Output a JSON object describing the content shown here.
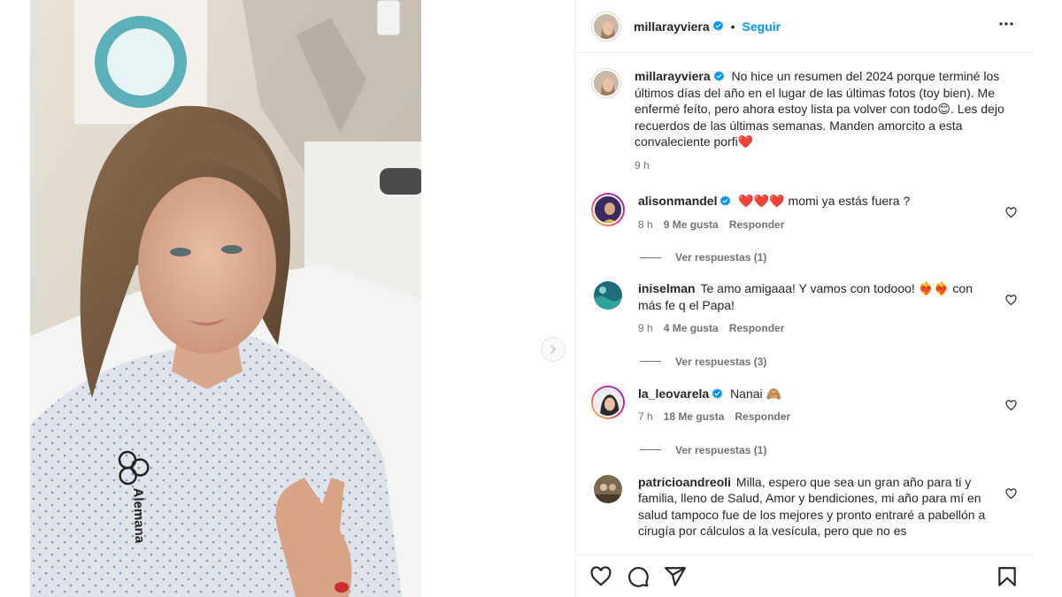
{
  "post": {
    "author": "millarayviera",
    "follow_label": "Seguir",
    "caption": "No hice un resumen del 2024 porque terminé los últimos días del año en el lugar de las últimas fotos (toy bien). Me enfermé feíto, pero ahora estoy lista pa volver con todo😊. Les dejo recuerdos de las últimas semanas. Manden amorcito a esta convaleciente porfi❤️",
    "caption_time": "9 h"
  },
  "photo": {
    "gown_logo_text": "Alemana"
  },
  "comments": [
    {
      "username": "alisonmandel",
      "verified": true,
      "text": "❤️❤️❤️ momi ya estás fuera ?",
      "time": "8 h",
      "likes": "9 Me gusta",
      "reply_label": "Responder",
      "view_replies": "Ver respuestas (1)"
    },
    {
      "username": "iniselman",
      "verified": false,
      "text": "Te amo amigaaa! Y vamos con todooo! ❤️‍🔥❤️‍🔥 con más fe q el Papa!",
      "time": "9 h",
      "likes": "4 Me gusta",
      "reply_label": "Responder",
      "view_replies": "Ver respuestas (3)"
    },
    {
      "username": "la_leovarela",
      "verified": true,
      "text": "Nanai 🙈",
      "time": "7 h",
      "likes": "18 Me gusta",
      "reply_label": "Responder",
      "view_replies": "Ver respuestas (1)"
    },
    {
      "username": "patricioandreoli",
      "verified": false,
      "text": "Milla, espero que sea un gran año para ti y familia, lleno de Salud, Amor y bendiciones, mi año para mí en salud tampoco fue de los mejores y pronto entraré a pabellón a cirugía por cálculos a la vesícula, pero que no es",
      "time": "",
      "likes": "",
      "reply_label": "",
      "view_replies": ""
    }
  ],
  "icons": {
    "verified": "verified-badge-icon",
    "more": "more-options-icon",
    "like": "heart-icon",
    "comment": "comment-icon",
    "share": "share-icon",
    "save": "bookmark-icon",
    "next": "chevron-right-icon"
  },
  "colors": {
    "accent": "#0095f6",
    "text": "#262626",
    "muted": "#737373",
    "border": "#efefef"
  }
}
